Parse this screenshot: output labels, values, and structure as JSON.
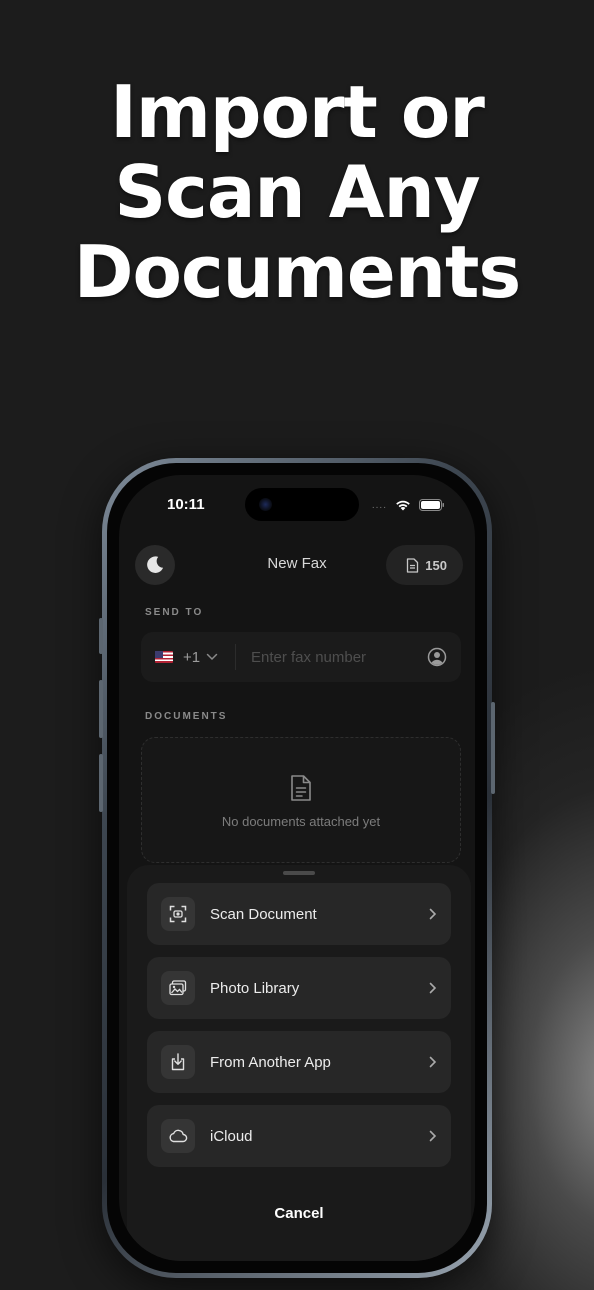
{
  "headline": {
    "line1": "Import or",
    "line2": "Scan Any",
    "line3": "Documents"
  },
  "status_bar": {
    "time": "10:11",
    "signal": "...."
  },
  "nav": {
    "title": "New Fax",
    "credits": "150",
    "theme_icon": "moon-icon",
    "credits_icon": "document-icon"
  },
  "send_to": {
    "label": "SEND TO",
    "country_code": "+1",
    "flag": "us-flag",
    "placeholder": "Enter fax number"
  },
  "documents": {
    "label": "DOCUMENTS",
    "empty_text": "No documents attached yet"
  },
  "sheet": {
    "options": [
      {
        "label": "Scan Document",
        "icon": "scan-icon"
      },
      {
        "label": "Photo Library",
        "icon": "photo-icon"
      },
      {
        "label": "From Another App",
        "icon": "import-icon"
      },
      {
        "label": "iCloud",
        "icon": "cloud-icon"
      }
    ],
    "cancel_label": "Cancel"
  },
  "colors": {
    "background": "#1c1c1c",
    "screen": "#141414",
    "row": "#272727",
    "text": "#ececec"
  }
}
